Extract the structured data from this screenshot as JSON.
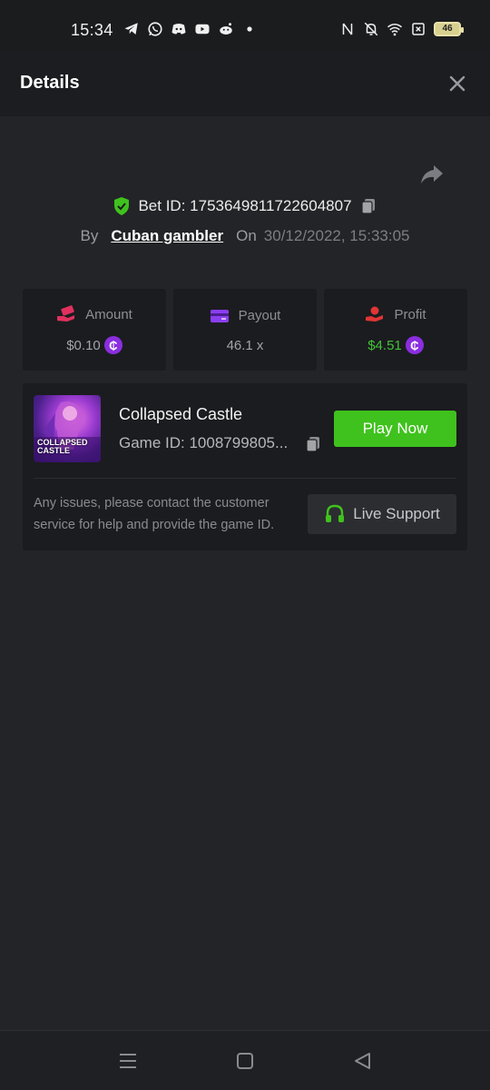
{
  "status_bar": {
    "time": "15:34",
    "left_icons": [
      "telegram-icon",
      "whatsapp-icon",
      "discord-icon",
      "youtube-icon",
      "reddit-icon",
      "dot-icon"
    ],
    "right_icons": [
      "nfc-icon",
      "bell-off-icon",
      "wifi-icon",
      "sim-off-icon"
    ],
    "battery": "46"
  },
  "header": {
    "title": "Details"
  },
  "bet": {
    "id_text": "Bet ID: 1753649811722604807",
    "by_label": "By",
    "user": "Cuban gambler",
    "on_label": "On",
    "date": "30/12/2022, 15:33:05"
  },
  "stats": {
    "amount": {
      "label": "Amount",
      "value": "$0.10"
    },
    "payout": {
      "label": "Payout",
      "value": "46.1 x"
    },
    "profit": {
      "label": "Profit",
      "value": "$4.51"
    },
    "coin_symbol": "₵"
  },
  "game": {
    "thumbnail_text": "COLLAPSED CASTLE",
    "name": "Collapsed Castle",
    "id_text": "Game ID: 1008799805...",
    "play_label": "Play Now",
    "help_text": "Any issues, please contact the customer service for help and provide the game ID.",
    "support_label": "Live Support"
  },
  "colors": {
    "accent_green": "#3fc21d",
    "profit_green": "#41c336",
    "coin_purple": "#8a2ee0",
    "amount_icon_pink": "#e0305e",
    "payout_icon_purple": "#8a3ef0",
    "profit_icon_red": "#e03535"
  }
}
